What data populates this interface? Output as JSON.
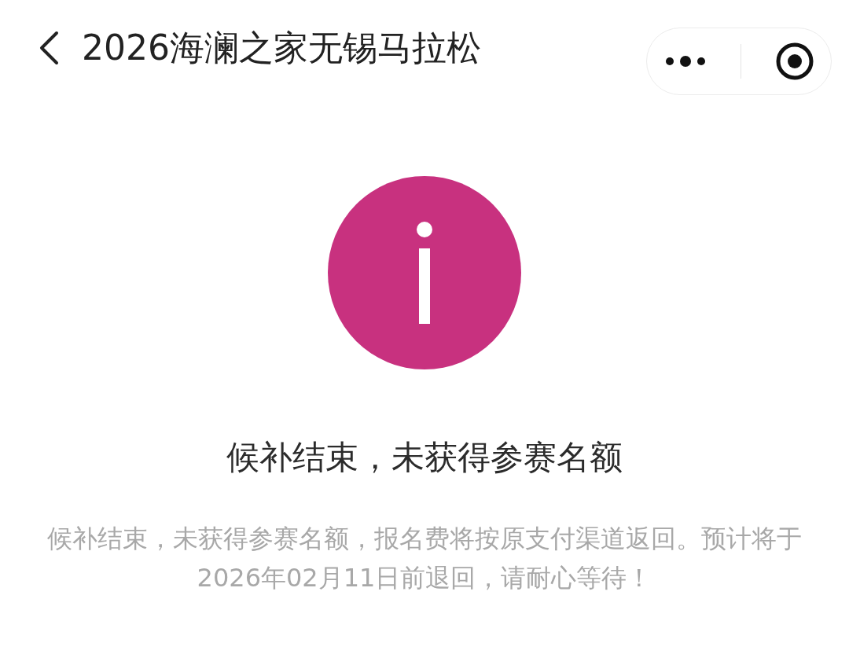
{
  "header": {
    "title": "2026海澜之家无锡马拉松"
  },
  "status": {
    "kind": "info",
    "color": "#c8317f",
    "heading": "候补结束，未获得参赛名额",
    "message": "候补结束，未获得参赛名额，报名费将按原支付渠道返回。预计将于2026年02月11日前退回，请耐心等待！"
  }
}
